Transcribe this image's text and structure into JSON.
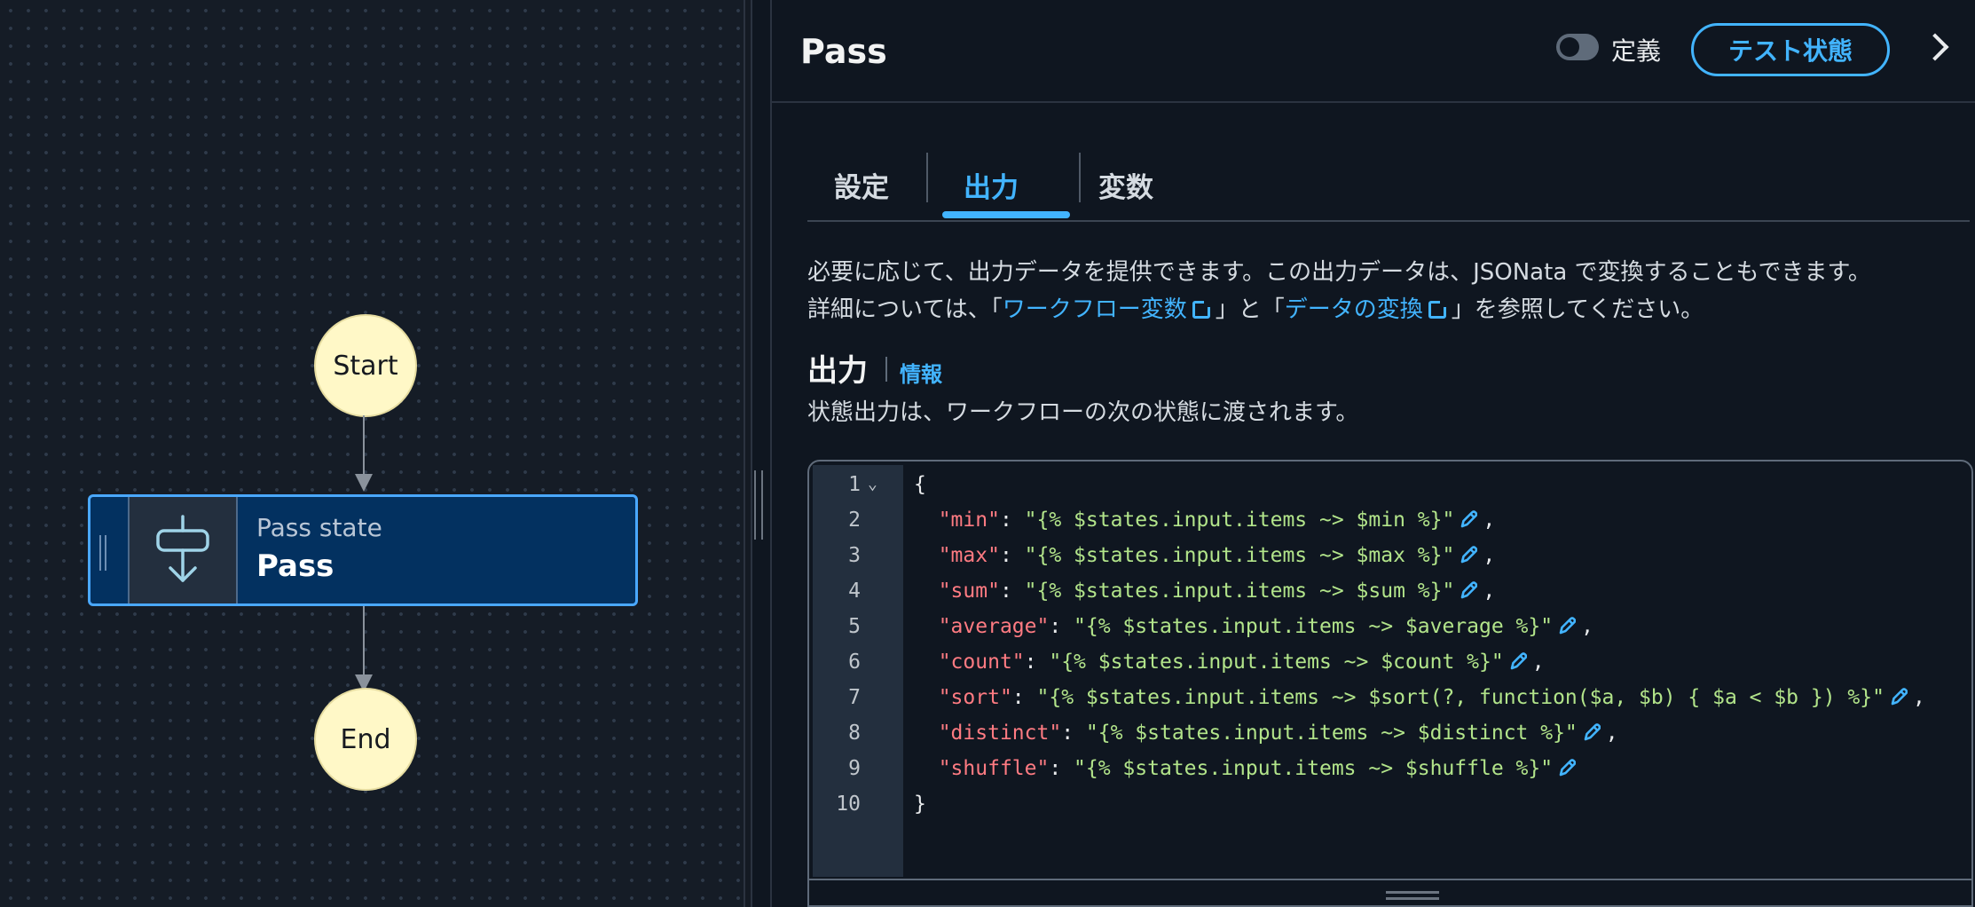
{
  "diagram": {
    "start_label": "Start",
    "end_label": "End",
    "state": {
      "type_label": "Pass state",
      "name": "Pass"
    }
  },
  "panel": {
    "title": "Pass",
    "toggle_label": "定義",
    "test_button_label": "テスト状態",
    "tabs": [
      {
        "label": "設定"
      },
      {
        "label": "出力",
        "active": true
      },
      {
        "label": "変数"
      }
    ],
    "description": {
      "line1": "必要に応じて、出力データを提供できます。この出力データは、JSONata で変換することもできます。",
      "line2_prefix": "詳細については、「",
      "link1": "ワークフロー変数",
      "line2_mid": "」と「",
      "link2": "データの変換",
      "line2_suffix": "」を参照してください。"
    },
    "section": {
      "title": "出力",
      "info_link": "情報",
      "subtitle": "状態出力は、ワークフローの次の状態に渡されます。"
    },
    "editor": {
      "open_brace": "{",
      "close_brace": "}",
      "fold_marker": "⌄",
      "line_numbers": [
        "1",
        "2",
        "3",
        "4",
        "5",
        "6",
        "7",
        "8",
        "9",
        "10"
      ],
      "entries": [
        {
          "key": "\"min\"",
          "value": "\"{% $states.input.items ~> $min %}\"",
          "comma": ","
        },
        {
          "key": "\"max\"",
          "value": "\"{% $states.input.items ~> $max %}\"",
          "comma": ","
        },
        {
          "key": "\"sum\"",
          "value": "\"{% $states.input.items ~> $sum %}\"",
          "comma": ","
        },
        {
          "key": "\"average\"",
          "value": "\"{% $states.input.items ~> $average %}\"",
          "comma": ","
        },
        {
          "key": "\"count\"",
          "value": "\"{% $states.input.items ~> $count %}\"",
          "comma": ","
        },
        {
          "key": "\"sort\"",
          "value": "\"{% $states.input.items ~> $sort(?, function($a, $b) { $a < $b }) %}\"",
          "comma": ","
        },
        {
          "key": "\"distinct\"",
          "value": "\"{% $states.input.items ~> $distinct %}\"",
          "comma": ","
        },
        {
          "key": "\"shuffle\"",
          "value": "\"{% $states.input.items ~> $shuffle %}\"",
          "comma": ""
        }
      ]
    }
  },
  "icons": {
    "pass_state": "pass-state-icon",
    "expand": "chevron-right-icon",
    "external": "external-link-icon",
    "edit": "pencil-icon"
  },
  "colors": {
    "accent": "#42b4ff",
    "node_fill": "#fff8c7",
    "state_fill": "#033160",
    "json_key": "#ff7b82",
    "json_string": "#b2e48a"
  }
}
